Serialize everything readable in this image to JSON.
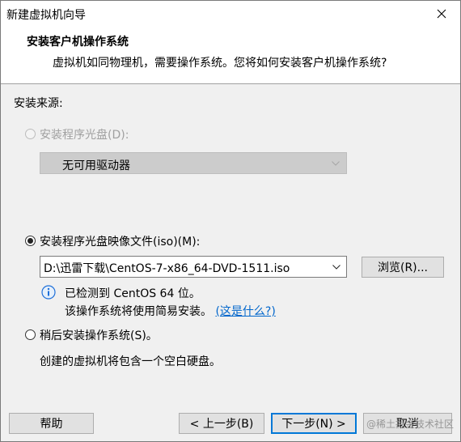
{
  "window": {
    "title": "新建虚拟机向导"
  },
  "header": {
    "title": "安装客户机操作系统",
    "subtitle": "虚拟机如同物理机，需要操作系统。您将如何安装客户机操作系统?"
  },
  "install_source": {
    "group_label": "安装来源:",
    "option_disc": {
      "label": "安装程序光盘(D):",
      "selected": false,
      "enabled": false
    },
    "disc_dropdown": {
      "value": "无可用驱动器",
      "enabled": false
    },
    "option_iso": {
      "label": "安装程序光盘映像文件(iso)(M):",
      "selected": true
    },
    "iso_path": {
      "value": "D:\\迅雷下载\\CentOS-7-x86_64-DVD-1511.iso"
    },
    "browse_label": "浏览(R)...",
    "detect_line": "已检测到 CentOS 64 位。",
    "easy_install_line": "该操作系统将使用简易安装。",
    "what_is_this_link": "(这是什么?)",
    "option_later": {
      "label": "稍后安装操作系统(S)。",
      "selected": false
    },
    "later_desc": "创建的虚拟机将包含一个空白硬盘。"
  },
  "footer": {
    "help_label": "帮助",
    "back_label": "< 上一步(B)",
    "next_label": "下一步(N) >",
    "cancel_label": "取消"
  },
  "watermark": "@稀土掘金技术社区",
  "colors": {
    "accent": "#0078d7",
    "link": "#0066cc",
    "info_icon": "#1e6fd9"
  }
}
